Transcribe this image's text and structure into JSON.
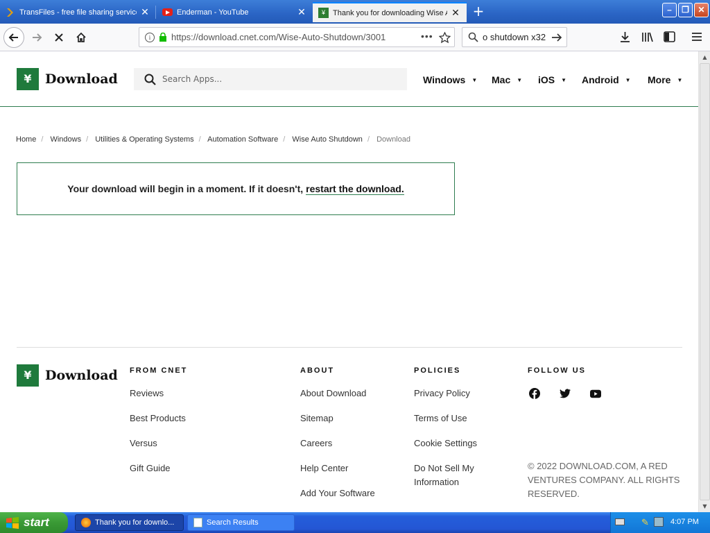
{
  "tabs": [
    {
      "title": "TransFiles - free file sharing service",
      "icon": "plex-icon"
    },
    {
      "title": "Enderman - YouTube",
      "icon": "youtube-icon"
    },
    {
      "title": "Thank you for downloading Wise Auto Shutdown",
      "icon": "download-icon"
    }
  ],
  "nav": {
    "url": "https://download.cnet.com/Wise-Auto-Shutdown/3001",
    "search_value": "o shutdown x32"
  },
  "site": {
    "logo_text": "Download",
    "search_placeholder": "Search Apps...",
    "menu": [
      "Windows",
      "Mac",
      "iOS",
      "Android",
      "More"
    ]
  },
  "breadcrumbs": [
    "Home",
    "Windows",
    "Utilities & Operating Systems",
    "Automation Software",
    "Wise Auto Shutdown",
    "Download"
  ],
  "message": {
    "text": "Your download will begin in a moment. If it doesn't,",
    "link": "restart the download."
  },
  "footer": {
    "logo_text": "Download",
    "columns": [
      {
        "heading": "FROM CNET",
        "links": [
          "Reviews",
          "Best Products",
          "Versus",
          "Gift Guide"
        ]
      },
      {
        "heading": "ABOUT",
        "links": [
          "About Download",
          "Sitemap",
          "Careers",
          "Help Center",
          "Add Your Software"
        ]
      },
      {
        "heading": "POLICIES",
        "links": [
          "Privacy Policy",
          "Terms of Use",
          "Cookie Settings",
          "Do Not Sell My Information"
        ]
      },
      {
        "heading": "FOLLOW US",
        "links": []
      }
    ],
    "social": [
      "facebook-icon",
      "twitter-icon",
      "youtube-icon"
    ],
    "copyright": "© 2022 DOWNLOAD.COM, A RED VENTURES COMPANY. ALL RIGHTS RESERVED."
  },
  "taskbar": {
    "start_label": "start",
    "tasks": [
      "Thank you for downlo...",
      "Search Results"
    ],
    "clock": "4:07 PM"
  },
  "colors": {
    "brand_green": "#1f7a3c",
    "xp_blue": "#245edb"
  }
}
